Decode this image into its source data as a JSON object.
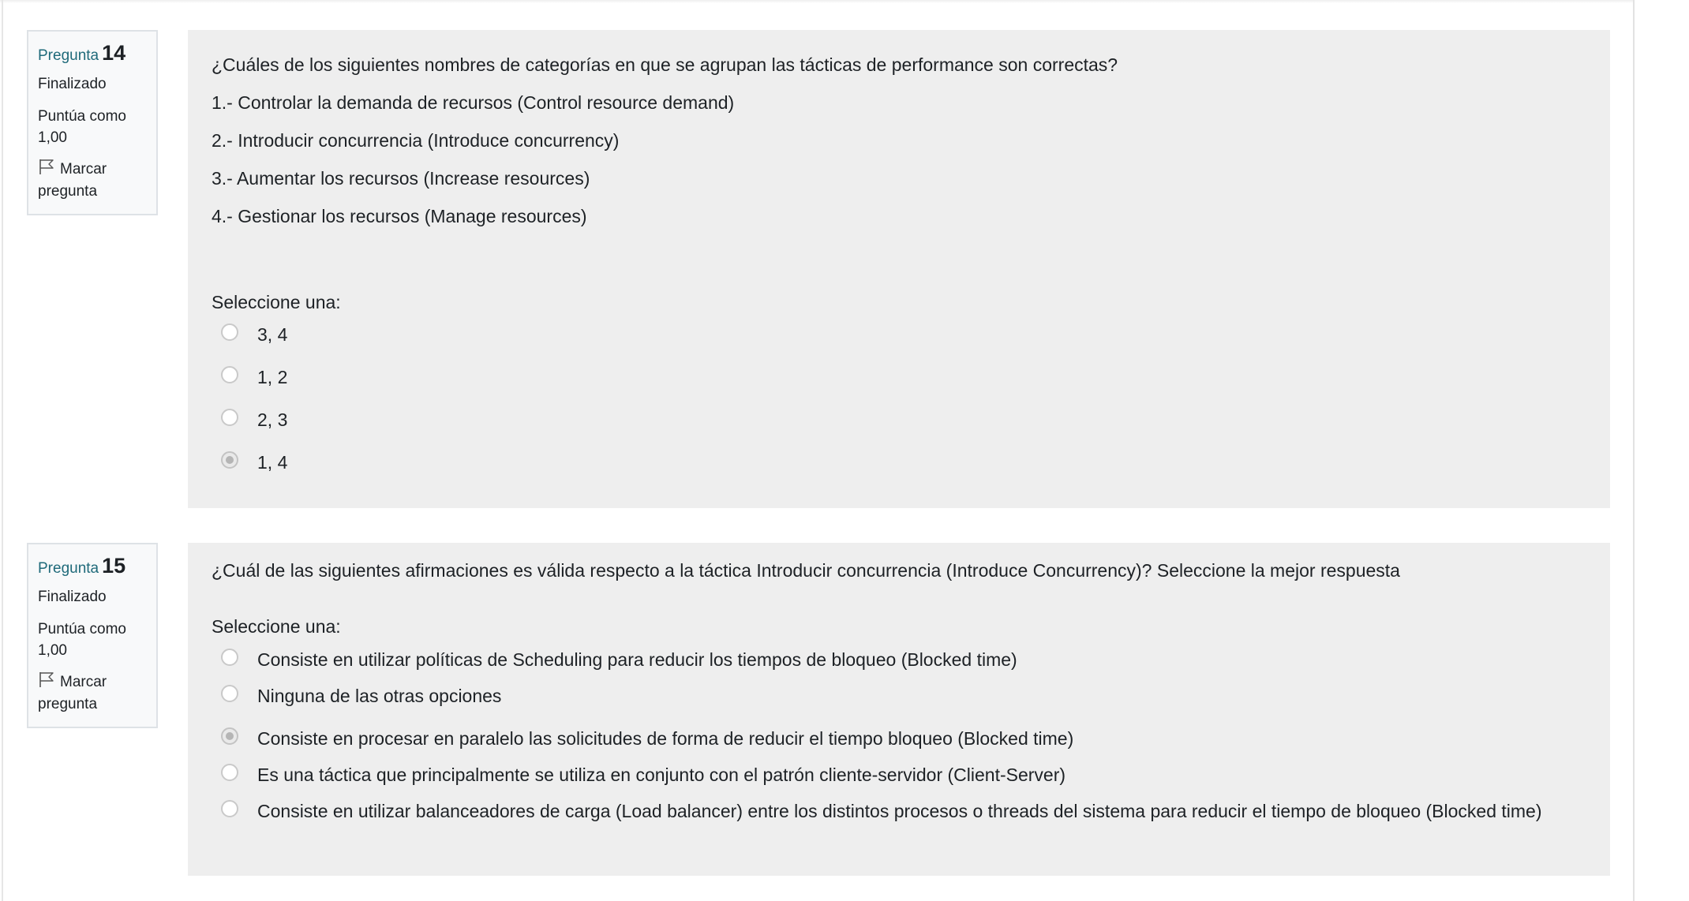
{
  "questions": [
    {
      "label": "Pregunta",
      "number": "14",
      "state": "Finalizado",
      "grade": "Puntúa como 1,00",
      "flag": "Marcar pregunta",
      "text": [
        "¿Cuáles de los siguientes nombres de categorías en que se agrupan las tácticas de performance son correctas?",
        "1.- Controlar la demanda de recursos (Control resource demand)",
        "2.- Introducir concurrencia (Introduce concurrency)",
        "3.- Aumentar los recursos (Increase resources)",
        "4.- Gestionar los recursos (Manage resources)"
      ],
      "prompt": "Seleccione una:",
      "options": [
        "3, 4",
        "1, 2",
        "2, 3",
        "1, 4"
      ],
      "selected_index": 3
    },
    {
      "label": "Pregunta",
      "number": "15",
      "state": "Finalizado",
      "grade": "Puntúa como 1,00",
      "flag": "Marcar pregunta",
      "text": [
        "¿Cuál de las siguientes afirmaciones es válida respecto a la táctica Introducir concurrencia (Introduce Concurrency)? Seleccione la mejor respuesta"
      ],
      "prompt": "Seleccione una:",
      "options": [
        "Consiste en utilizar políticas de Scheduling para reducir los tiempos de bloqueo (Blocked time)",
        "Ninguna de las otras opciones",
        "Consiste en procesar en paralelo las solicitudes de forma de reducir el tiempo bloqueo (Blocked time)",
        "Es una táctica que principalmente se utiliza en conjunto con el patrón cliente-servidor (Client-Server)",
        "Consiste en utilizar balanceadores de carga (Load balancer) entre los distintos procesos o threads del sistema para reducir el tiempo de bloqueo (Blocked time)"
      ],
      "selected_index": 2
    }
  ],
  "icons": {
    "flag": "flag-icon",
    "radio": "radio-button"
  },
  "colors": {
    "info_label": "#1f6a7a",
    "content_bg": "#eeeeee",
    "info_bg": "#f8f9fa"
  }
}
